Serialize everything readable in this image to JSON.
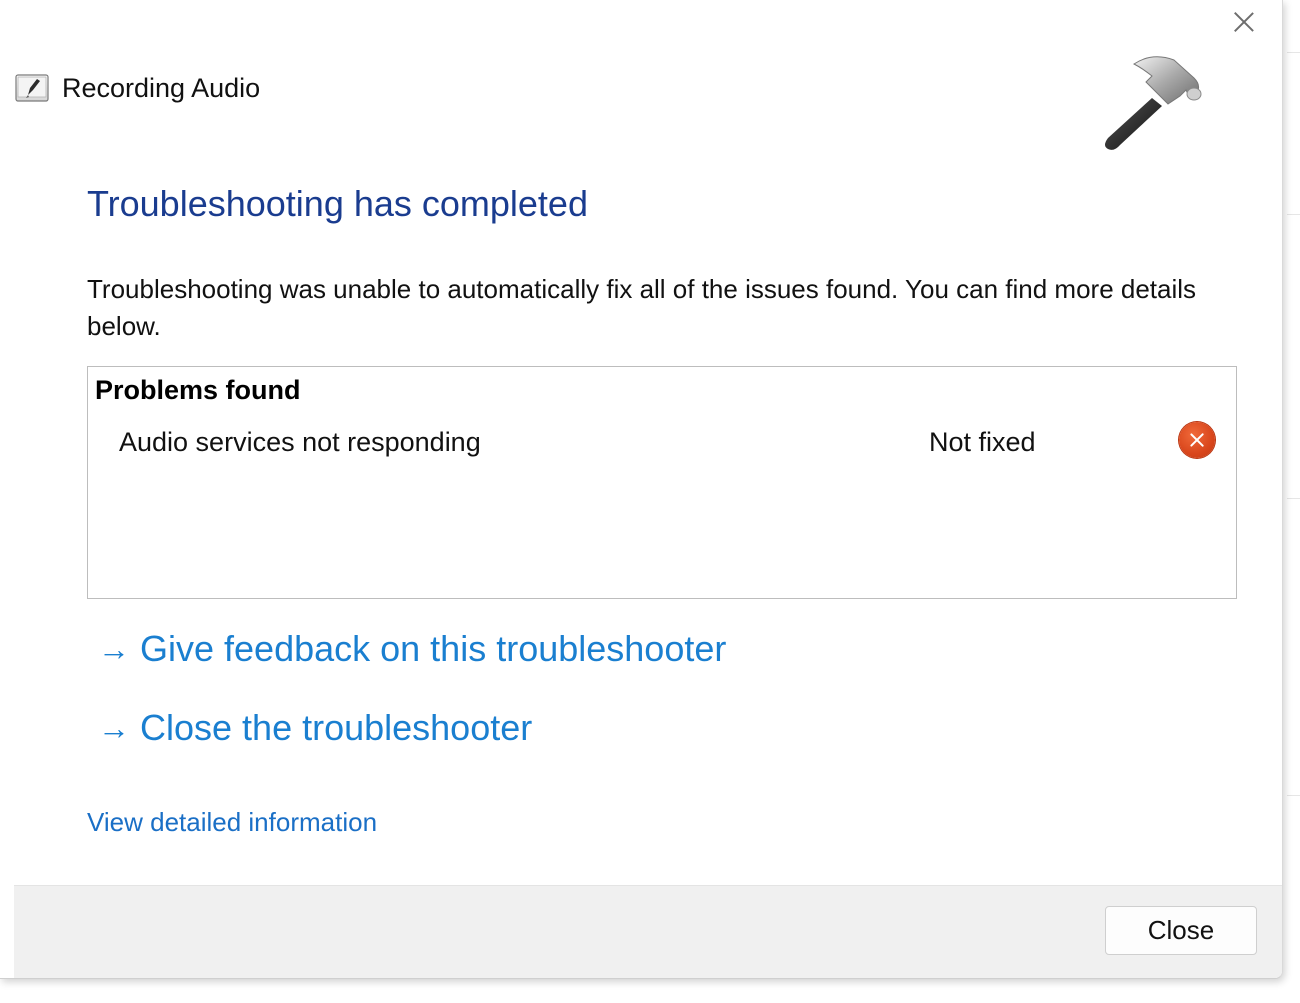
{
  "window": {
    "title": "Recording Audio",
    "close_icon": "close-icon",
    "app_icon": "audio-recording-icon",
    "header_image": "hammer-icon"
  },
  "main": {
    "heading": "Troubleshooting has completed",
    "description": "Troubleshooting was unable to automatically fix all of the issues found. You can find more details below.",
    "problems": {
      "header": "Problems found",
      "items": [
        {
          "name": "Audio services not responding",
          "status": "Not fixed",
          "status_icon": "error-icon",
          "status_color": "#d9461c"
        }
      ]
    },
    "links": [
      {
        "arrow": "→",
        "label": "Give feedback on this troubleshooter"
      },
      {
        "arrow": "→",
        "label": "Close the troubleshooter"
      }
    ],
    "detail_link": "View detailed information"
  },
  "footer": {
    "close_button": "Close"
  },
  "colors": {
    "heading": "#1a3c8f",
    "link": "#1a7fd0",
    "footer_bg": "#f0f0f0"
  }
}
